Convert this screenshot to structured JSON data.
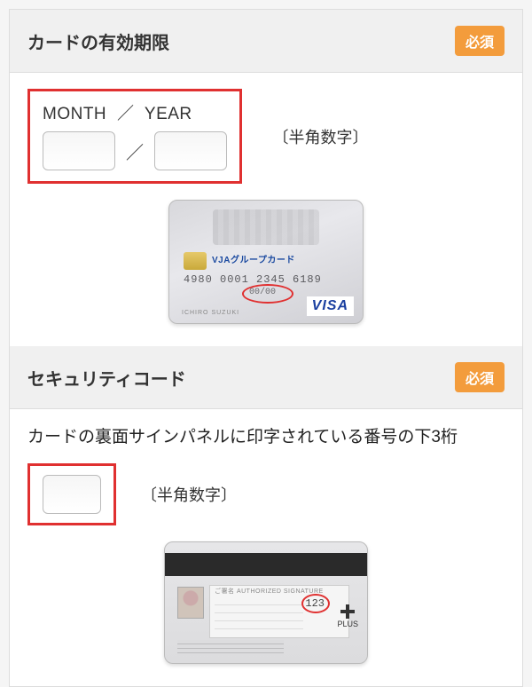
{
  "expiry": {
    "title": "カードの有効期限",
    "required_label": "必須",
    "month_label": "MONTH",
    "separator_label": "／",
    "year_label": "YEAR",
    "input_separator": "／",
    "hint": "〔半角数字〕",
    "card": {
      "brand_text": "VJAグループカード",
      "number": "4980 0001 2345 6189",
      "expiry_text": "00/00",
      "holder": "ICHIRO  SUZUKI",
      "logo": "VISA"
    }
  },
  "security": {
    "title": "セキュリティコード",
    "required_label": "必須",
    "description": "カードの裏面サインパネルに印字されている番号の下3桁",
    "hint": "〔半角数字〕",
    "card": {
      "auth_label": "ご署名 AUTHORIZED SIGNATURE",
      "cvv": "123",
      "network": "PLUS"
    }
  }
}
